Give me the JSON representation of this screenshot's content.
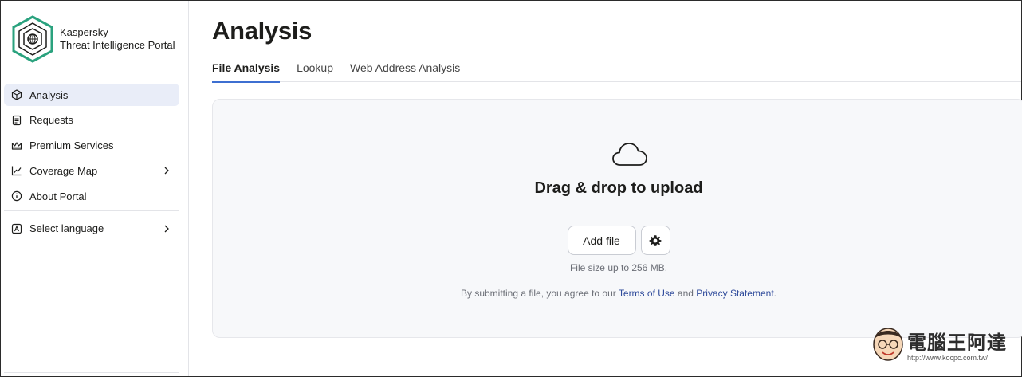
{
  "brand": {
    "line1": "Kaspersky",
    "line2": "Threat Intelligence Portal",
    "accent": "#2aa27e"
  },
  "sidebar": {
    "items": [
      {
        "label": "Analysis",
        "icon": "cube-icon",
        "active": true
      },
      {
        "label": "Requests",
        "icon": "document-icon"
      },
      {
        "label": "Premium Services",
        "icon": "crown-icon"
      },
      {
        "label": "Coverage Map",
        "icon": "chart-icon",
        "has_submenu": true
      },
      {
        "label": "About Portal",
        "icon": "info-icon"
      }
    ],
    "language": {
      "label": "Select language",
      "icon": "language-icon",
      "has_submenu": true
    }
  },
  "main": {
    "title": "Analysis",
    "tabs": [
      {
        "label": "File Analysis",
        "active": true
      },
      {
        "label": "Lookup"
      },
      {
        "label": "Web Address Analysis"
      }
    ],
    "upload": {
      "icon": "cloud-icon",
      "title": "Drag & drop to upload",
      "add_file_label": "Add file",
      "settings_icon": "gear-icon",
      "size_note": "File size up to 256 MB.",
      "terms_prefix": "By submitting a file, you agree to our ",
      "terms_link": "Terms of Use",
      "terms_mid": " and ",
      "privacy_link": "Privacy Statement",
      "terms_suffix": "."
    }
  },
  "watermark": {
    "text": "電腦王阿達",
    "url": "http://www.kocpc.com.tw/"
  },
  "colors": {
    "active_tab_underline": "#3d6fd1",
    "active_nav_bg": "#e9edf8",
    "link": "#2f4b9b"
  }
}
